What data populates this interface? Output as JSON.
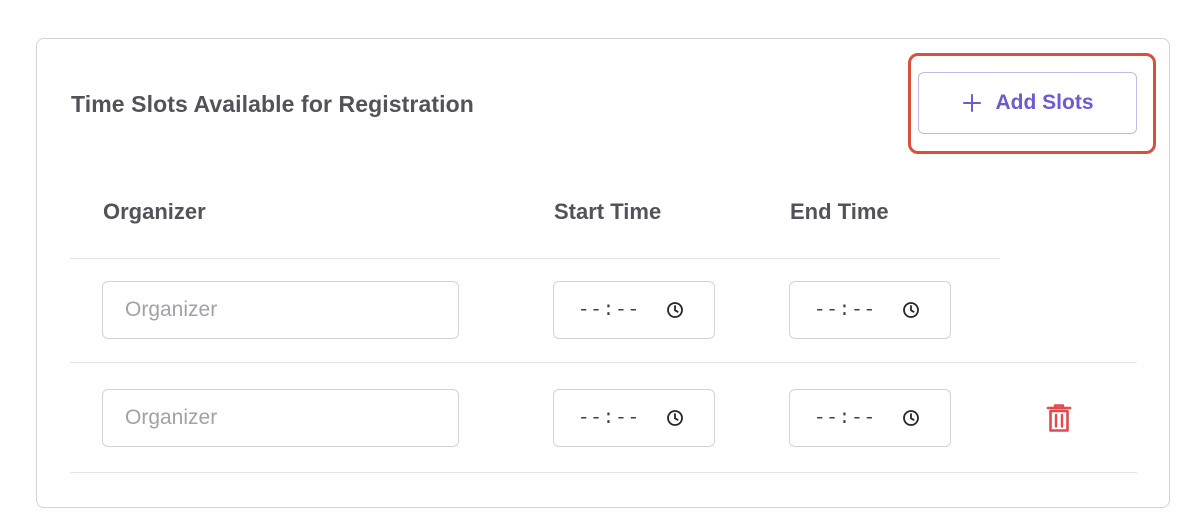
{
  "card": {
    "title": "Time Slots Available for Registration",
    "add_button_label": "Add Slots"
  },
  "table": {
    "columns": [
      "Organizer",
      "Start Time",
      "End Time"
    ],
    "rows": [
      {
        "organizer": {
          "value": "",
          "placeholder": "Organizer"
        },
        "start_time": "--:--",
        "end_time": "--:--",
        "deletable": false
      },
      {
        "organizer": {
          "value": "",
          "placeholder": "Organizer"
        },
        "start_time": "--:--",
        "end_time": "--:--",
        "deletable": true
      }
    ]
  },
  "icons": {
    "add": "plus-icon",
    "time": "clock-icon",
    "delete": "trash-icon"
  },
  "colors": {
    "accent": "#6d5bd0",
    "highlight": "#d9503f",
    "danger": "#e5484d",
    "border": "#d4d4d8"
  }
}
